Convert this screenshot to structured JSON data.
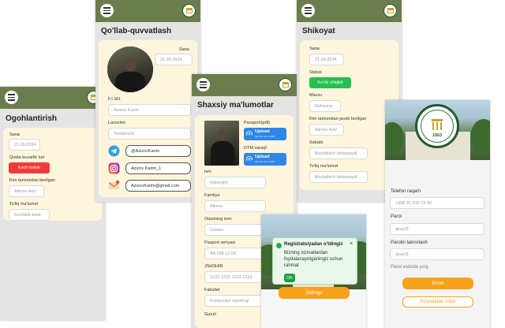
{
  "warning_screen": {
    "title": "Ogohlantirish",
    "date_label": "Sana",
    "date_value": "21.09.2024",
    "violation_label": "Qoida buzarlik turi",
    "violation_value": "Kech kelish",
    "issuer_label": "Kim tamonidan berilgan",
    "issuer_value": "Alimov Aziz",
    "details_label": "To'liq ma'lumot",
    "details_value": "Kechikib  keldi"
  },
  "support_screen": {
    "title": "Qo'llab-quvvatlash",
    "date_label": "Sana",
    "date_value": "21.09.2024",
    "name_label": "F.I.SH.",
    "name_value": "Azizov Karim",
    "position_label": "Lavozimi",
    "position_value": "Yordamchi",
    "telegram": "@AzizovKarim",
    "instagram": "Azizov Karim_1",
    "email": "AzizovKarim@gmail.com"
  },
  "complaint_screen": {
    "title": "Shikoyat",
    "date_label": "Sana",
    "date_value": "21.09.2024",
    "status_label": "Status",
    "status_value": "Ko'rib chiqildi",
    "topic_label": "Mavzu",
    "topic_value": "Oshxona",
    "responder_label": "Kim tamonidan javob berilgan",
    "responder_value": "Alimov Aziz",
    "reason_label": "Sababi",
    "reason_value": "Muzlatkich ishlamaydi",
    "details_label": "To'liq ma'lumot",
    "details_value": "Muzlatkich ishlamaydi"
  },
  "personal_screen": {
    "title": "Shaxsiy ma'lumotlar",
    "passport_label": "Passport(pdf)",
    "dtm_label": "DTM varaq'i",
    "upload_label": "Upload",
    "upload_hint": "Max file size 10MB",
    "first_name_label": "Ism",
    "first_name_placeholder": "Hakimjon",
    "last_name_label": "Familya",
    "last_name_placeholder": "Alimov",
    "father_name_label": "Otasining ismi",
    "father_name_placeholder": "Usmon",
    "passport_series_label": "Pasport seriyasi",
    "passport_series_placeholder": "AA 098 12 09",
    "pinfl_label": "JSHSHIR",
    "pinfl_placeholder": "1333 1233 1233 1233",
    "faculty_label": "Fakultet",
    "faculty_placeholder": "Kompyuter injiniringi",
    "group_label": "Guruh"
  },
  "success_toast": {
    "title": "Registratsiyadan o'tdingiz",
    "message": "Bizning xizmatlardan foydalanayotganingiz uchun rahmat",
    "ok": "OK",
    "next_button": "Oldinga"
  },
  "register_screen": {
    "emblem_year": "1953",
    "phone_label": "Telefon raqam",
    "phone_placeholder": "+998 91 010 19 99",
    "password_label": "Parol",
    "password_placeholder": "alua19",
    "password_repeat_label": "Parolni takrorlash",
    "password_repeat_placeholder": "alua19",
    "forgot_label": "Parol esimda yo'q",
    "login_button": "Kirish",
    "register_button": "Ro'yxatdan o'tish"
  },
  "colors": {
    "header": "#6b7d4d",
    "card": "#fdf6dd",
    "danger": "#f2393a",
    "success": "#25c04d",
    "accent": "#f7a21b",
    "upload": "#2f86e8"
  },
  "icons": [
    "menu-icon",
    "university-logo-icon",
    "telegram-icon",
    "instagram-icon",
    "mail-icon",
    "upload-cloud-icon",
    "check-circle-icon",
    "close-icon"
  ]
}
